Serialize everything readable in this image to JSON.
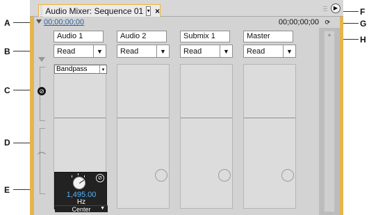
{
  "callouts": {
    "a": "A",
    "b": "B",
    "c": "C",
    "d": "D",
    "e": "E",
    "f": "F",
    "g": "G",
    "h": "H"
  },
  "panel": {
    "tab_title": "Audio Mixer: Sequence 01",
    "tab_dropdown": "▾",
    "close": "×",
    "menu": "▶",
    "timecode_left": "00;00;00;00",
    "timecode_right": "00;00;00;00",
    "loop_icon": "⟳"
  },
  "tracks": [
    {
      "name": "Audio 1",
      "automation": "Read"
    },
    {
      "name": "Audio 2",
      "automation": "Read"
    },
    {
      "name": "Submix 1",
      "automation": "Read"
    },
    {
      "name": "Master",
      "automation": "Read"
    }
  ],
  "effect": {
    "name": "Bandpass",
    "value": "1,495.00",
    "unit": "Hz",
    "channel": "Center"
  },
  "colors": {
    "panel": "#e6b54a",
    "accent": "#f0b13a",
    "timecode": "#2e5e9e",
    "value": "#4fb3ff"
  },
  "icons": {
    "collapse": "triangle-down",
    "knob": "knob",
    "send": "send",
    "menu": "circle-arrow"
  }
}
